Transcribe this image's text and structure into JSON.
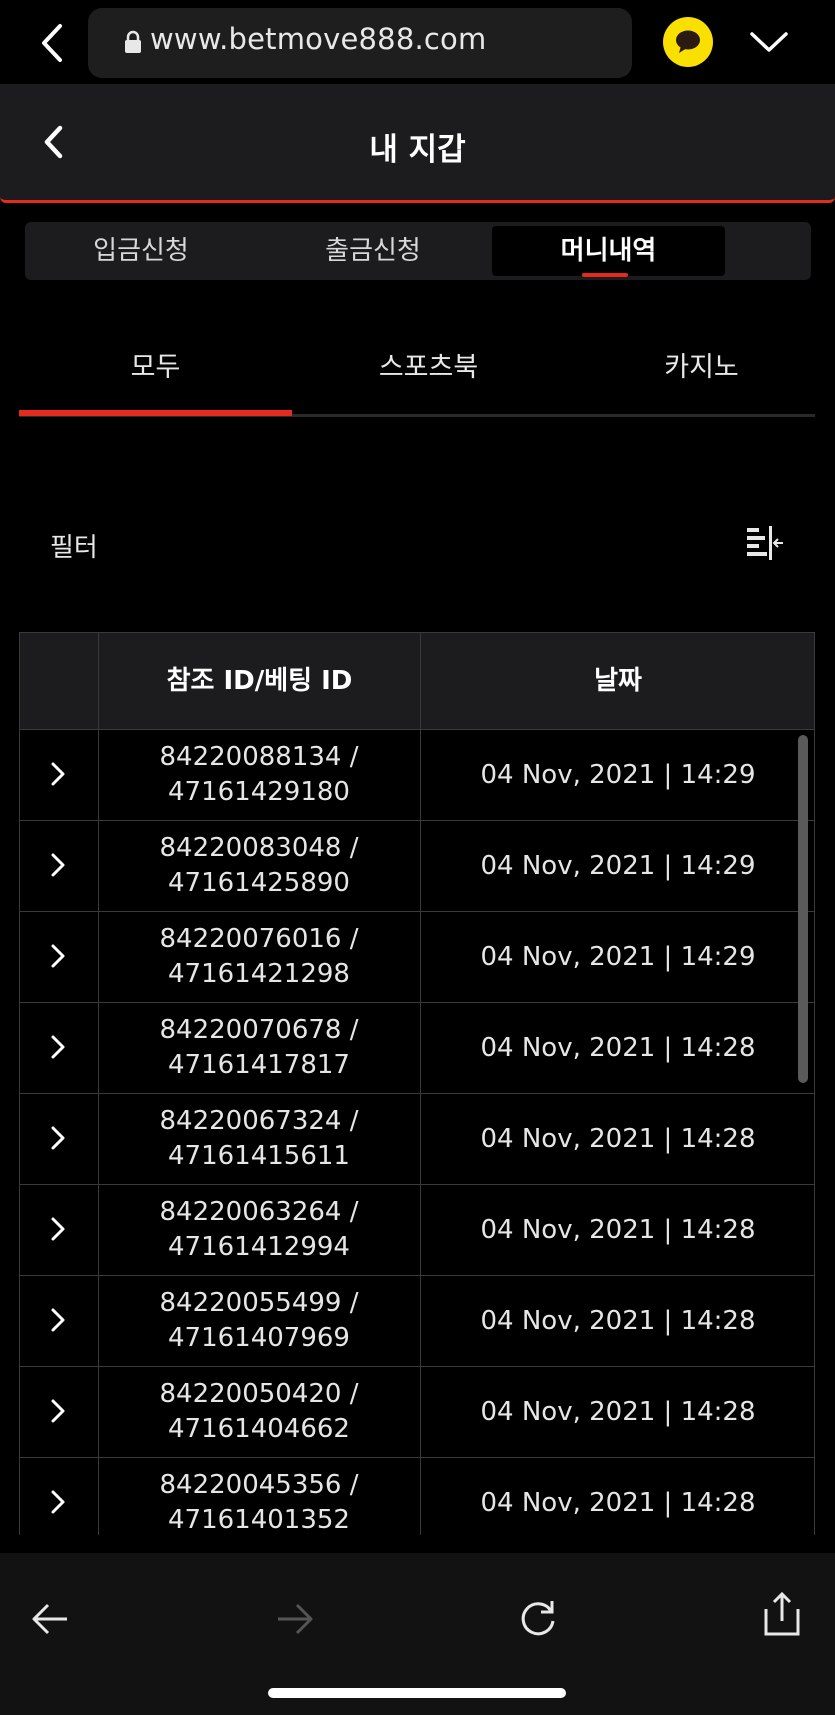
{
  "browser": {
    "url": "www.betmove888.com",
    "icons": [
      "back-chevron-icon",
      "lock-icon",
      "kakao-chat-icon",
      "chevron-down-icon"
    ]
  },
  "header": {
    "title": "내 지갑"
  },
  "segment_tabs": [
    {
      "label": "입금신청",
      "active": false
    },
    {
      "label": "출금신청",
      "active": false
    },
    {
      "label": "머니내역",
      "active": true
    }
  ],
  "sub_tabs": [
    {
      "label": "모두",
      "active": true
    },
    {
      "label": "스포츠북",
      "active": false
    },
    {
      "label": "카지노",
      "active": false
    }
  ],
  "filter": {
    "label": "필터",
    "icon": "filter-collapse-icon"
  },
  "table": {
    "columns": [
      "",
      "참조 ID/베팅 ID",
      "날짜"
    ],
    "rows": [
      {
        "ref_id": "84220088134 /",
        "bet_id": "47161429180",
        "date": "04 Nov, 2021 | 14:29"
      },
      {
        "ref_id": "84220083048 /",
        "bet_id": "47161425890",
        "date": "04 Nov, 2021 | 14:29"
      },
      {
        "ref_id": "84220076016 /",
        "bet_id": "47161421298",
        "date": "04 Nov, 2021 | 14:29"
      },
      {
        "ref_id": "84220070678 /",
        "bet_id": "47161417817",
        "date": "04 Nov, 2021 | 14:28"
      },
      {
        "ref_id": "84220067324 /",
        "bet_id": "47161415611",
        "date": "04 Nov, 2021 | 14:28"
      },
      {
        "ref_id": "84220063264 /",
        "bet_id": "47161412994",
        "date": "04 Nov, 2021 | 14:28"
      },
      {
        "ref_id": "84220055499 /",
        "bet_id": "47161407969",
        "date": "04 Nov, 2021 | 14:28"
      },
      {
        "ref_id": "84220050420 /",
        "bet_id": "47161404662",
        "date": "04 Nov, 2021 | 14:28"
      },
      {
        "ref_id": "84220045356 /",
        "bet_id": "47161401352",
        "date": "04 Nov, 2021 | 14:28"
      }
    ]
  },
  "colors": {
    "accent": "#e52a1e",
    "kakao": "#f9e000",
    "header_bg": "#1c1c1e"
  }
}
